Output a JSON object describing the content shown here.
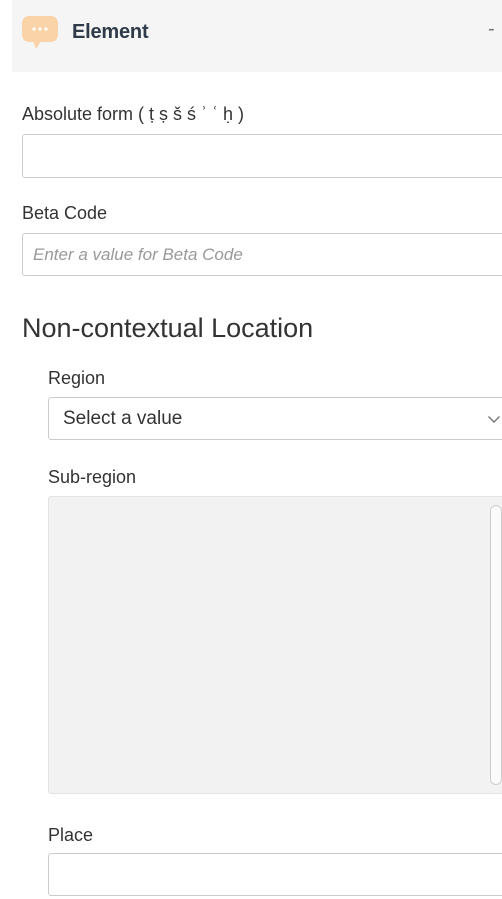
{
  "header": {
    "title": "Element",
    "collapse_label": "-",
    "icon": "speech-bubble-icon",
    "icon_color": "#fbd3a8"
  },
  "fields": {
    "absolute_form": {
      "label": "Absolute form ( ṭ ṣ š ś ʾ ʿ ḥ )",
      "value": ""
    },
    "beta_code": {
      "label": "Beta Code",
      "value": "",
      "placeholder": "Enter a value for Beta Code"
    }
  },
  "location": {
    "title": "Non-contextual Location",
    "region": {
      "label": "Region",
      "selected": "Select a value"
    },
    "subregion": {
      "label": "Sub-region"
    },
    "place": {
      "label": "Place",
      "value": ""
    }
  }
}
